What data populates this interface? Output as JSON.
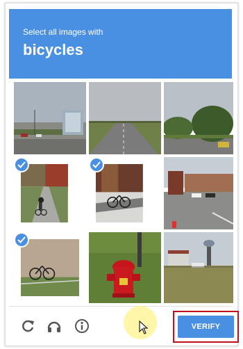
{
  "challenge": {
    "instruction": "Select all images with",
    "target": "bicycles"
  },
  "tiles": [
    {
      "id": 1,
      "selected": false
    },
    {
      "id": 2,
      "selected": false
    },
    {
      "id": 3,
      "selected": false
    },
    {
      "id": 4,
      "selected": true
    },
    {
      "id": 5,
      "selected": true
    },
    {
      "id": 6,
      "selected": false
    },
    {
      "id": 7,
      "selected": true
    },
    {
      "id": 8,
      "selected": false
    },
    {
      "id": 9,
      "selected": false
    }
  ],
  "footer": {
    "verify_label": "VERIFY",
    "icons": [
      "reload-icon",
      "audio-icon",
      "info-icon"
    ]
  },
  "colors": {
    "accent": "#4a90e2",
    "highlight_outline": "#c0111a",
    "cursor_halo": "#fff59a"
  }
}
